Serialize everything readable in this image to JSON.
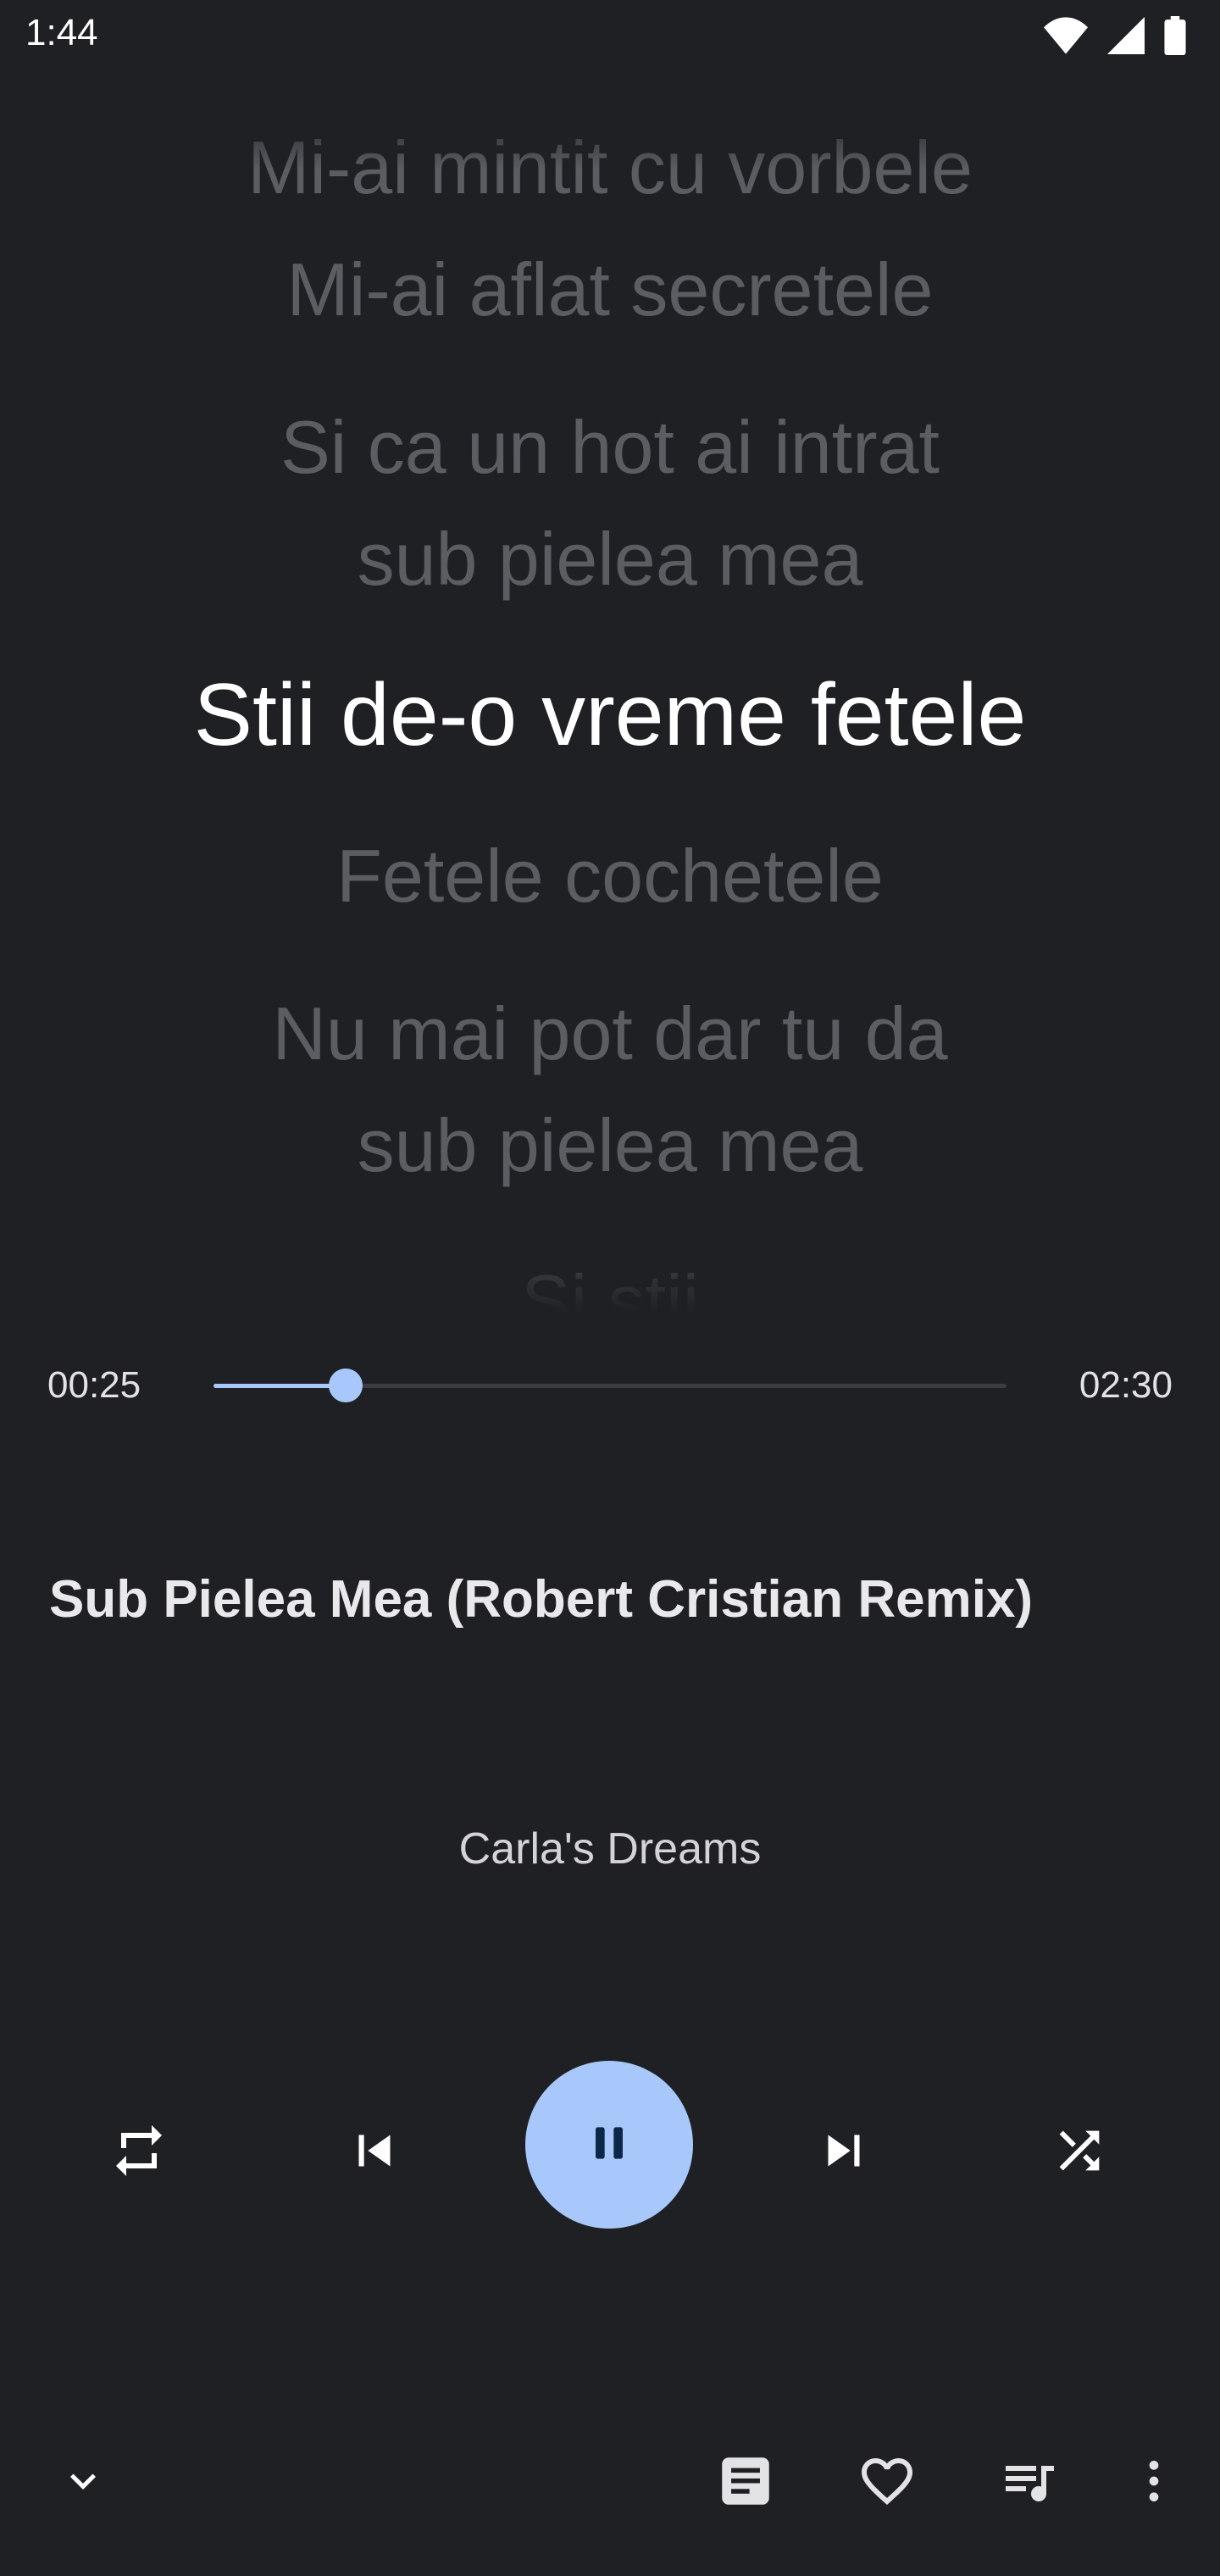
{
  "status_bar": {
    "time": "1:44",
    "icons": [
      "wifi-icon",
      "signal-icon",
      "battery-icon"
    ]
  },
  "lyrics": {
    "lines": [
      {
        "text": "Mi-ai mintit cu vorbele",
        "state": "past"
      },
      {
        "text": "Mi-ai aflat secretele",
        "state": "past"
      },
      {
        "text": "Si ca un hot ai intrat",
        "state": "past"
      },
      {
        "text": "sub pielea mea",
        "state": "past"
      },
      {
        "text": "Stii de-o vreme fetele",
        "state": "current"
      },
      {
        "text": "Fetele cochetele",
        "state": "upcoming"
      },
      {
        "text": "Nu mai pot dar tu da",
        "state": "upcoming"
      },
      {
        "text": "sub pielea mea",
        "state": "upcoming"
      },
      {
        "text": "Si stii",
        "state": "upcoming"
      }
    ]
  },
  "player": {
    "elapsed": "00:25",
    "duration": "02:30",
    "progress": 0.167,
    "title": "Sub Pielea Mea (Robert Cristian Remix)",
    "artist": "Carla's Dreams"
  },
  "controls": {
    "icons": [
      "repeat-icon",
      "skip-previous-icon",
      "pause-icon",
      "skip-next-icon",
      "shuffle-icon"
    ]
  },
  "bottom_bar": {
    "icons": [
      "chevron-down-icon",
      "lyrics-icon",
      "heart-icon",
      "queue-icon",
      "more-vert-icon"
    ]
  },
  "colors": {
    "background": "#1f2024",
    "accent": "#a8c8fb",
    "lyric_dim": "#5b5d62",
    "lyric_active": "#ffffff"
  }
}
